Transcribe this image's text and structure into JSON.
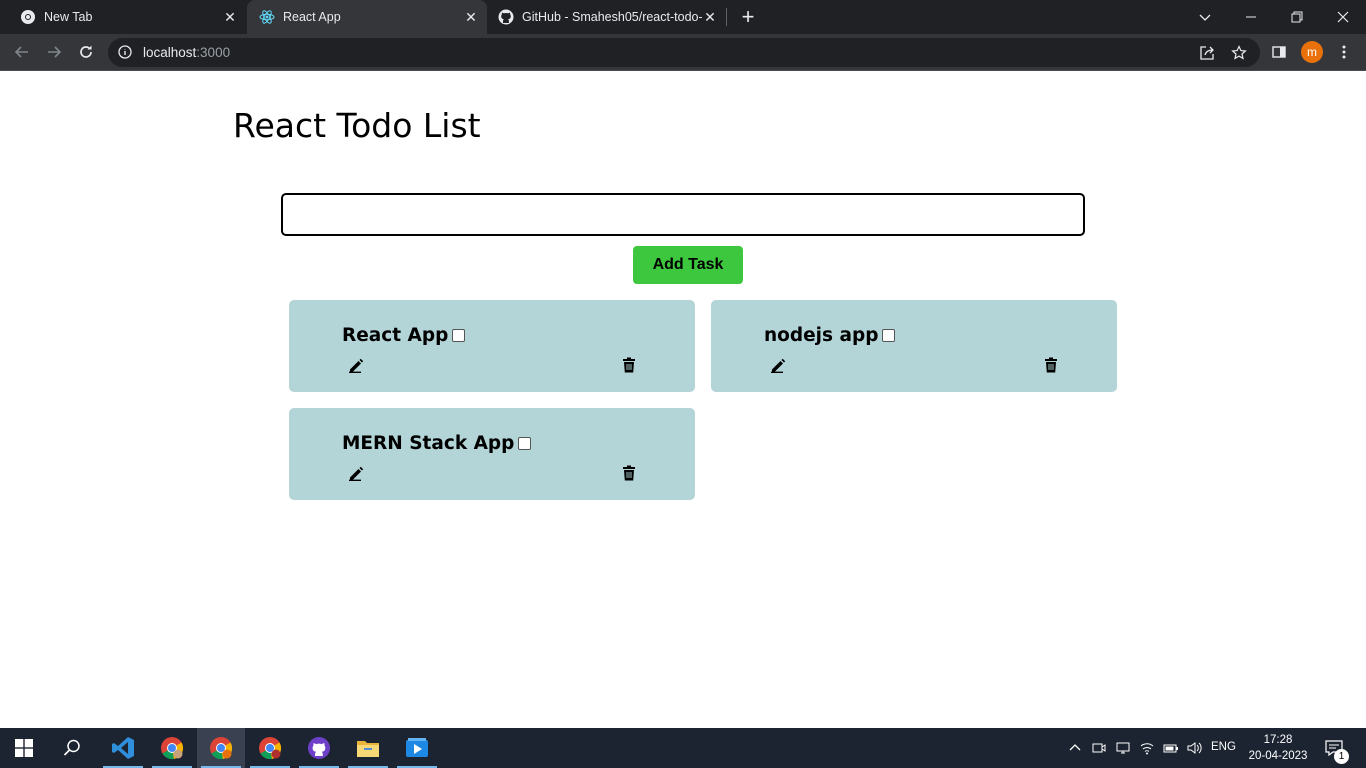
{
  "browser": {
    "tabs": [
      {
        "title": "New Tab",
        "icon": "chrome-icon",
        "active": false
      },
      {
        "title": "React App",
        "icon": "react-icon",
        "active": true
      },
      {
        "title": "GitHub - Smahesh05/react-todo-",
        "icon": "github-icon",
        "active": false
      }
    ],
    "address": {
      "host": "localhost",
      "port": ":3000"
    },
    "profile_initial": "m"
  },
  "app": {
    "title": "React Todo List",
    "input_value": "",
    "add_button_label": "Add Task",
    "tasks": [
      {
        "name": "React App",
        "done": false
      },
      {
        "name": "nodejs app",
        "done": false
      },
      {
        "name": "MERN Stack App",
        "done": false
      }
    ],
    "card_color": "#b3d5d8",
    "button_color": "#3cc73e"
  },
  "taskbar": {
    "language": "ENG",
    "time": "17:28",
    "date": "20-04-2023",
    "notifications": "1"
  }
}
